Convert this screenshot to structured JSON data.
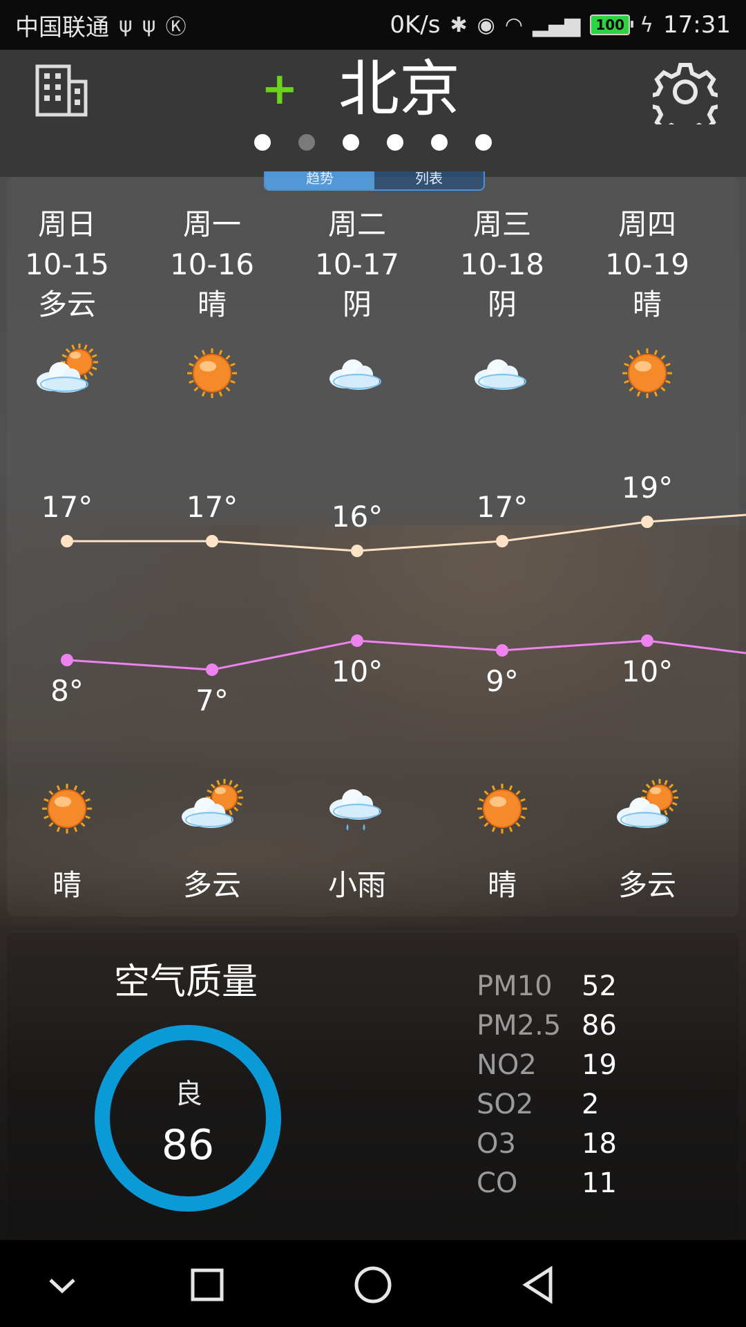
{
  "status_bar": {
    "carrier": "中国联通",
    "speed": "0K/s",
    "battery": "100",
    "time": "17:31",
    "icons": [
      "usb-icon",
      "usb-icon",
      "k-icon",
      "bluetooth-icon",
      "eye-icon",
      "wifi-icon",
      "signal-4g-icon",
      "battery-icon",
      "charging-icon"
    ]
  },
  "header": {
    "city": "北京",
    "icons": {
      "left": "city-building-icon",
      "add": "add-icon",
      "settings": "gear-icon"
    },
    "add_symbol": "+",
    "page_dots": 6,
    "active_dot_index": 1
  },
  "toggle": {
    "labels": [
      "趋势",
      "列表"
    ]
  },
  "forecast": {
    "days": [
      {
        "weekday": "周日",
        "date": "10-15",
        "day_weather": "多云",
        "day_icon": "partly-cloudy-icon",
        "high": "17°",
        "low": "8°",
        "night_icon": "sun-icon",
        "night_weather": "晴"
      },
      {
        "weekday": "周一",
        "date": "10-16",
        "day_weather": "晴",
        "day_icon": "sun-icon",
        "high": "17°",
        "low": "7°",
        "night_icon": "partly-cloudy-icon",
        "night_weather": "多云"
      },
      {
        "weekday": "周二",
        "date": "10-17",
        "day_weather": "阴",
        "day_icon": "cloud-icon",
        "high": "16°",
        "low": "10°",
        "night_icon": "rain-cloud-icon",
        "night_weather": "小雨"
      },
      {
        "weekday": "周三",
        "date": "10-18",
        "day_weather": "阴",
        "day_icon": "cloud-icon",
        "high": "17°",
        "low": "9°",
        "night_icon": "sun-icon",
        "night_weather": "晴"
      },
      {
        "weekday": "周四",
        "date": "10-19",
        "day_weather": "晴",
        "day_icon": "sun-icon",
        "high": "19°",
        "low": "10°",
        "night_icon": "partly-cloudy-icon",
        "night_weather": "多云"
      }
    ],
    "colors": {
      "high_line": "#ffe3c4",
      "low_line": "#ee82ee"
    }
  },
  "chart_data": {
    "type": "line",
    "categories": [
      "10-15",
      "10-16",
      "10-17",
      "10-18",
      "10-19"
    ],
    "series": [
      {
        "values": [
          17,
          17,
          16,
          17,
          19
        ]
      },
      {
        "values": [
          8,
          7,
          10,
          9,
          10
        ]
      }
    ]
  },
  "air_quality": {
    "title": "空气质量",
    "level": "良",
    "aqi": "86",
    "ring_color": "#0a9ad8",
    "pollutants": [
      {
        "name": "PM10",
        "value": "52"
      },
      {
        "name": "PM2.5",
        "value": "86"
      },
      {
        "name": "NO2",
        "value": "19"
      },
      {
        "name": "SO2",
        "value": "2"
      },
      {
        "name": "O3",
        "value": "18"
      },
      {
        "name": "CO",
        "value": "11"
      }
    ]
  },
  "nav_bar": {
    "icons": [
      "chevron-down-icon",
      "recent-apps-icon",
      "home-icon",
      "back-icon"
    ]
  }
}
